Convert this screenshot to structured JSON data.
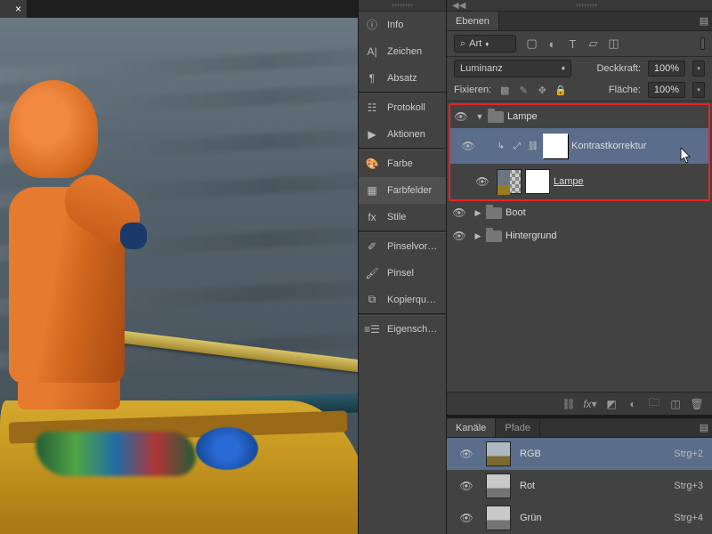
{
  "sidebar": {
    "items": [
      {
        "icon": "ⓘ",
        "label": "Info"
      },
      {
        "icon": "A|",
        "label": "Zeichen"
      },
      {
        "icon": "¶",
        "label": "Absatz"
      },
      {
        "sep": true
      },
      {
        "icon": "☷",
        "label": "Protokoll"
      },
      {
        "icon": "▶",
        "label": "Aktionen"
      },
      {
        "sep": true
      },
      {
        "icon": "🎨",
        "label": "Farbe"
      },
      {
        "icon": "▦",
        "label": "Farbfelder",
        "active": true
      },
      {
        "icon": "fx",
        "label": "Stile"
      },
      {
        "sep": true
      },
      {
        "icon": "✐",
        "label": "Pinselvorga..."
      },
      {
        "icon": "🖌",
        "label": "Pinsel"
      },
      {
        "icon": "⧉",
        "label": "Kopierquelle"
      },
      {
        "sep": true
      },
      {
        "icon": "≡☰",
        "label": "Eigenschaft..."
      }
    ]
  },
  "layers_panel": {
    "tab_label": "Ebenen",
    "filter_label": "Art",
    "blend_mode": "Luminanz",
    "opacity_label": "Deckkraft:",
    "opacity_value": "100%",
    "lock_label": "Fixieren:",
    "fill_label": "Fläche:",
    "fill_value": "100%",
    "groups": {
      "lampe": "Lampe",
      "adjustment": "Kontrastkorrektur",
      "lampe_layer": "Lampe",
      "boot": "Boot",
      "hintergrund": "Hintergrund"
    }
  },
  "channels_panel": {
    "tab_labels": [
      "Kanäle",
      "Pfade"
    ],
    "channels": [
      {
        "name": "RGB",
        "shortcut": "Strg+2",
        "selected": true,
        "color": true
      },
      {
        "name": "Rot",
        "shortcut": "Strg+3"
      },
      {
        "name": "Grün",
        "shortcut": "Strg+4"
      }
    ]
  }
}
